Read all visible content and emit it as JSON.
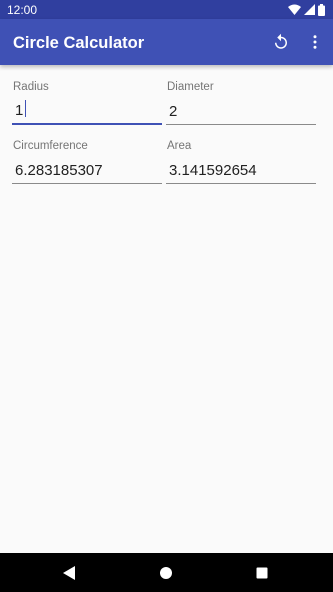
{
  "status_bar": {
    "time": "12:00",
    "icons": [
      "wifi-icon",
      "signal-icon",
      "battery-icon"
    ]
  },
  "app_bar": {
    "title": "Circle Calculator",
    "actions": [
      "reset-icon",
      "overflow-menu-icon"
    ]
  },
  "fields": {
    "radius": {
      "label": "Radius",
      "value": "1"
    },
    "diameter": {
      "label": "Diameter",
      "value": "2"
    },
    "circumference": {
      "label": "Circumference",
      "value": "6.283185307"
    },
    "area": {
      "label": "Area",
      "value": "3.141592654"
    }
  },
  "nav_bar": {
    "buttons": [
      "back-icon",
      "home-icon",
      "recents-icon"
    ]
  },
  "colors": {
    "primary": "#3f51b5",
    "primary_dark": "#303f9f",
    "background": "#fafafa"
  }
}
